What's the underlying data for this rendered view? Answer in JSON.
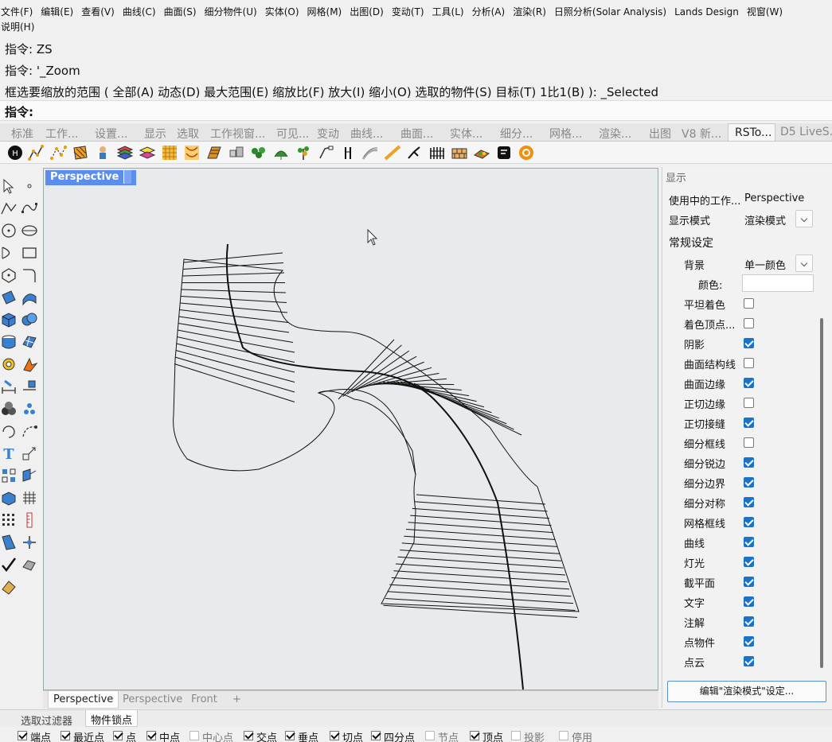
{
  "menu": {
    "row1": [
      "文件(F)",
      "编辑(E)",
      "查看(V)",
      "曲线(C)",
      "曲面(S)",
      "细分物件(U)",
      "实体(O)",
      "网格(M)",
      "出图(D)",
      "变动(T)",
      "工具(L)",
      "分析(A)",
      "渲染(R)",
      "日照分析(Solar Analysis)",
      "Lands Design",
      "视窗(W)"
    ],
    "row2": [
      "说明(H)"
    ]
  },
  "command": {
    "history": [
      "指令: ZS",
      "指令: '_Zoom",
      "框选要缩放的范围 ( 全部(A)  动态(D)  最大范围(E)  缩放比(F)  放大(I)  缩小(O)  选取的物件(S)  目标(T)  1比1(B) ): _Selected"
    ],
    "prompt": "指令:"
  },
  "toolbar_tabs": [
    "标准",
    "工作...",
    "设置...",
    "显示",
    "选取",
    "工作视窗...",
    "可见...",
    "变动",
    "曲线...",
    "曲面...",
    "实体...",
    "细分...",
    "网格...",
    "渲染...",
    "出图",
    "V8 新...",
    "RSTo...",
    "D5 LiveS..."
  ],
  "toolbar_active_tab": "RSTo...",
  "viewport": {
    "title": "Perspective",
    "tabs": [
      "Perspective",
      "Perspective",
      "Front"
    ],
    "active_tab": 0,
    "add_tab_glyph": "+"
  },
  "panel": {
    "header": "显示",
    "active_viewport_label": "使用中的工作...",
    "active_viewport_value": "Perspective",
    "display_mode_label": "显示模式",
    "display_mode_value": "渲染模式",
    "general_settings": "常规设定",
    "background_label": "背景",
    "background_value": "单一颜色",
    "color_label": "颜色:",
    "options": [
      {
        "label": "平坦着色",
        "checked": false
      },
      {
        "label": "着色顶点...",
        "checked": false
      },
      {
        "label": "阴影",
        "checked": true
      },
      {
        "label": "曲面结构线",
        "checked": false
      },
      {
        "label": "曲面边缘",
        "checked": true
      },
      {
        "label": "正切边缘",
        "checked": false
      },
      {
        "label": "正切接缝",
        "checked": true
      },
      {
        "label": "细分框线",
        "checked": false
      },
      {
        "label": "细分锐边",
        "checked": true
      },
      {
        "label": "细分边界",
        "checked": true
      },
      {
        "label": "细分对称",
        "checked": true
      },
      {
        "label": "网格框线",
        "checked": true
      },
      {
        "label": "曲线",
        "checked": true
      },
      {
        "label": "灯光",
        "checked": true
      },
      {
        "label": "截平面",
        "checked": true
      },
      {
        "label": "文字",
        "checked": true
      },
      {
        "label": "注解",
        "checked": true
      },
      {
        "label": "点物件",
        "checked": true
      },
      {
        "label": "点云",
        "checked": true
      }
    ],
    "edit_button": "编辑\"渲染模式\"设定..."
  },
  "bottom_tabs": [
    "选取过滤器",
    "物件锁点"
  ],
  "bottom_active_tab": 1,
  "osnaps": [
    {
      "label": "端点",
      "checked": true
    },
    {
      "label": "最近点",
      "checked": true
    },
    {
      "label": "点",
      "checked": true
    },
    {
      "label": "中点",
      "checked": true
    },
    {
      "label": "中心点",
      "checked": false
    },
    {
      "label": "交点",
      "checked": true
    },
    {
      "label": "垂点",
      "checked": true
    },
    {
      "label": "切点",
      "checked": true
    },
    {
      "label": "四分点",
      "checked": true
    },
    {
      "label": "节点",
      "checked": false
    },
    {
      "label": "顶点",
      "checked": true
    },
    {
      "label": "投影",
      "checked": false
    },
    {
      "label": "停用",
      "checked": false
    }
  ],
  "colors": {
    "viewport_title_bg": "#5b8def",
    "checkbox_checked": "#1a73c8",
    "viewport_bg": "#e8ebed"
  }
}
